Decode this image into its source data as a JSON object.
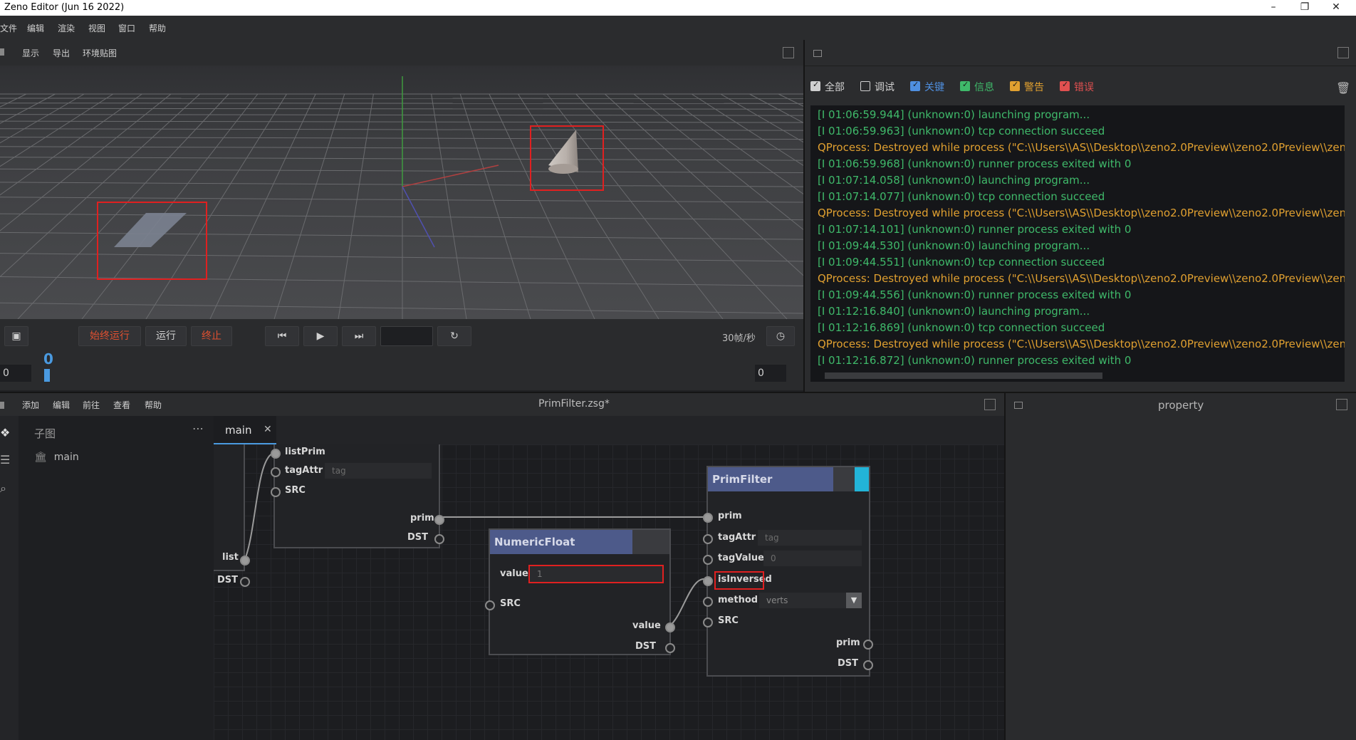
{
  "window": {
    "title": "Zeno Editor (Jun 16 2022)"
  },
  "menu": [
    "文件",
    "编辑",
    "渲染",
    "视图",
    "窗口",
    "帮助"
  ],
  "viewport_toolbar": [
    "显示",
    "导出",
    "环境贴图"
  ],
  "controls": {
    "always_run": "始终运行",
    "run": "运行",
    "stop": "终止",
    "fps": "30帧/秒",
    "frame_start": "0",
    "frame_current": "0",
    "frame_end": "0"
  },
  "log": {
    "filters": [
      {
        "label": "全部",
        "checked": true,
        "color": "#d0d0d0",
        "box": "#d0d0d0"
      },
      {
        "label": "调试",
        "checked": false,
        "color": "#d0d0d0",
        "box": "#d0d0d0"
      },
      {
        "label": "关键",
        "checked": true,
        "color": "#4f8fe0",
        "box": "#4f8fe0"
      },
      {
        "label": "信息",
        "checked": true,
        "color": "#3fb96a",
        "box": "#3fb96a"
      },
      {
        "label": "警告",
        "checked": true,
        "color": "#e0a030",
        "box": "#e0a030"
      },
      {
        "label": "错误",
        "checked": true,
        "color": "#e05050",
        "box": "#e05050"
      }
    ],
    "lines": [
      {
        "text": "[I 01:06:59.944] (unknown:0) launching program...",
        "color": "#3fb96a"
      },
      {
        "text": "[I 01:06:59.963] (unknown:0) tcp connection succeed",
        "color": "#3fb96a"
      },
      {
        "text": "QProcess: Destroyed while process (\"C:\\\\Users\\\\AS\\\\Desktop\\\\zeno2.0Preview\\\\zeno2.0Preview\\\\zenoe",
        "color": "#e0a030"
      },
      {
        "text": "[I 01:06:59.968] (unknown:0) runner process exited with 0",
        "color": "#3fb96a"
      },
      {
        "text": "[I 01:07:14.058] (unknown:0) launching program...",
        "color": "#3fb96a"
      },
      {
        "text": "[I 01:07:14.077] (unknown:0) tcp connection succeed",
        "color": "#3fb96a"
      },
      {
        "text": "QProcess: Destroyed while process (\"C:\\\\Users\\\\AS\\\\Desktop\\\\zeno2.0Preview\\\\zeno2.0Preview\\\\zenoe",
        "color": "#e0a030"
      },
      {
        "text": "[I 01:07:14.101] (unknown:0) runner process exited with 0",
        "color": "#3fb96a"
      },
      {
        "text": "[I 01:09:44.530] (unknown:0) launching program...",
        "color": "#3fb96a"
      },
      {
        "text": "[I 01:09:44.551] (unknown:0) tcp connection succeed",
        "color": "#3fb96a"
      },
      {
        "text": "QProcess: Destroyed while process (\"C:\\\\Users\\\\AS\\\\Desktop\\\\zeno2.0Preview\\\\zeno2.0Preview\\\\zenoe",
        "color": "#e0a030"
      },
      {
        "text": "[I 01:09:44.556] (unknown:0) runner process exited with 0",
        "color": "#3fb96a"
      },
      {
        "text": "[I 01:12:16.840] (unknown:0) launching program...",
        "color": "#3fb96a"
      },
      {
        "text": "[I 01:12:16.869] (unknown:0) tcp connection succeed",
        "color": "#3fb96a"
      },
      {
        "text": "QProcess: Destroyed while process (\"C:\\\\Users\\\\AS\\\\Desktop\\\\zeno2.0Preview\\\\zeno2.0Preview\\\\zenoe",
        "color": "#e0a030"
      },
      {
        "text": "[I 01:12:16.872] (unknown:0) runner process exited with 0",
        "color": "#3fb96a"
      }
    ]
  },
  "graph_menu": [
    "添加",
    "编辑",
    "前往",
    "查看",
    "帮助"
  ],
  "graph_title": "PrimFilter.zsg*",
  "subgraph": {
    "header": "子图",
    "item": "main"
  },
  "tab": {
    "label": "main"
  },
  "property": {
    "title": "property"
  },
  "nodes": {
    "partial": {
      "inputs": [
        "listPrim",
        "tagAttr",
        "SRC"
      ],
      "tag_placeholder": "tag",
      "outputs": [
        "prim",
        "DST"
      ],
      "left_outputs": [
        "list",
        "DST"
      ]
    },
    "numeric_float": {
      "title": "NumericFloat",
      "value_label": "value",
      "value": "1",
      "src": "SRC",
      "outputs": [
        "value",
        "DST"
      ]
    },
    "prim_filter": {
      "title": "PrimFilter",
      "inputs": [
        "prim",
        "tagAttr",
        "tagValue",
        "isInversed",
        "method",
        "SRC"
      ],
      "tagAttr_value": "tag",
      "tagValue_value": "0",
      "method_value": "verts",
      "outputs": [
        "prim",
        "DST"
      ]
    }
  }
}
